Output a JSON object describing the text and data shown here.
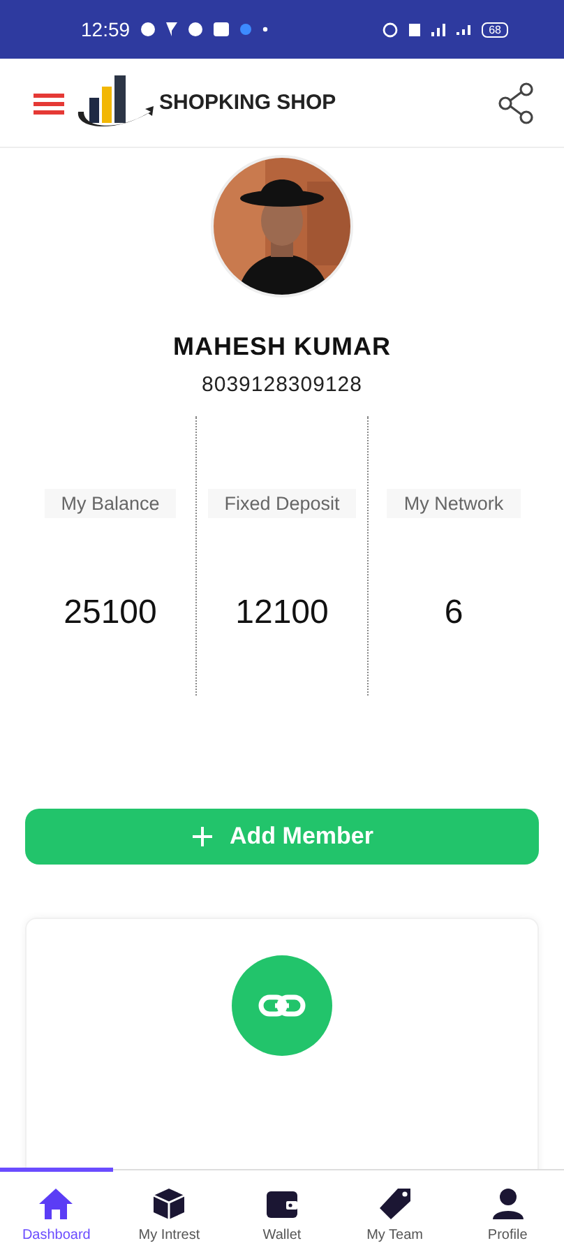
{
  "status_bar": {
    "time": "12:59",
    "battery": "68"
  },
  "header": {
    "title": "SHOPKING SHOP"
  },
  "profile": {
    "name": "MAHESH KUMAR",
    "phone": "8039128309128"
  },
  "stats": [
    {
      "label": "My Balance",
      "value": "25100"
    },
    {
      "label": "Fixed Deposit",
      "value": "12100"
    },
    {
      "label": "My Network",
      "value": "6"
    }
  ],
  "add_button": {
    "label": "Add Member"
  },
  "bottom_nav": [
    {
      "label": "Dashboard",
      "kind": "home",
      "selected": true
    },
    {
      "label": "My Intrest",
      "kind": "box",
      "selected": false
    },
    {
      "label": "Wallet",
      "kind": "wallet",
      "selected": false
    },
    {
      "label": "My Team",
      "kind": "tag",
      "selected": false
    },
    {
      "label": "Profile",
      "kind": "person",
      "selected": false
    }
  ]
}
